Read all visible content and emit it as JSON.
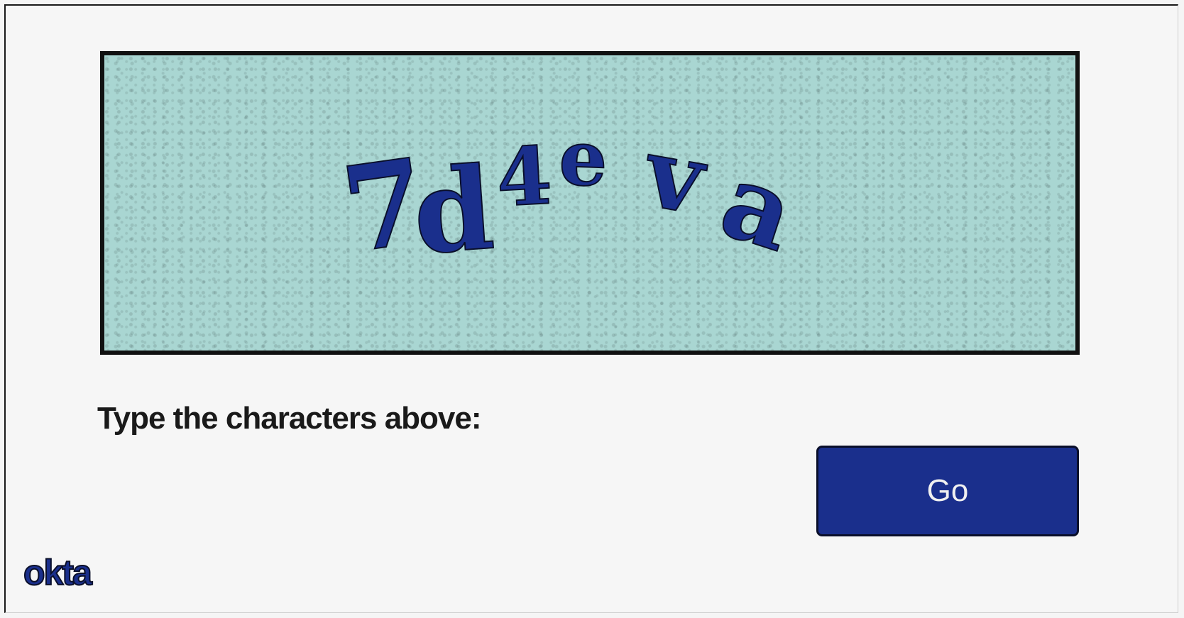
{
  "captcha": {
    "text": "7d4eva"
  },
  "form": {
    "prompt": "Type the characters above:",
    "go_label": "Go"
  },
  "brand": {
    "logo_text": "okta"
  },
  "colors": {
    "captcha_background": "#a9d6d2",
    "captcha_text": "#1a2f8c",
    "button": "#1a2f8c"
  }
}
